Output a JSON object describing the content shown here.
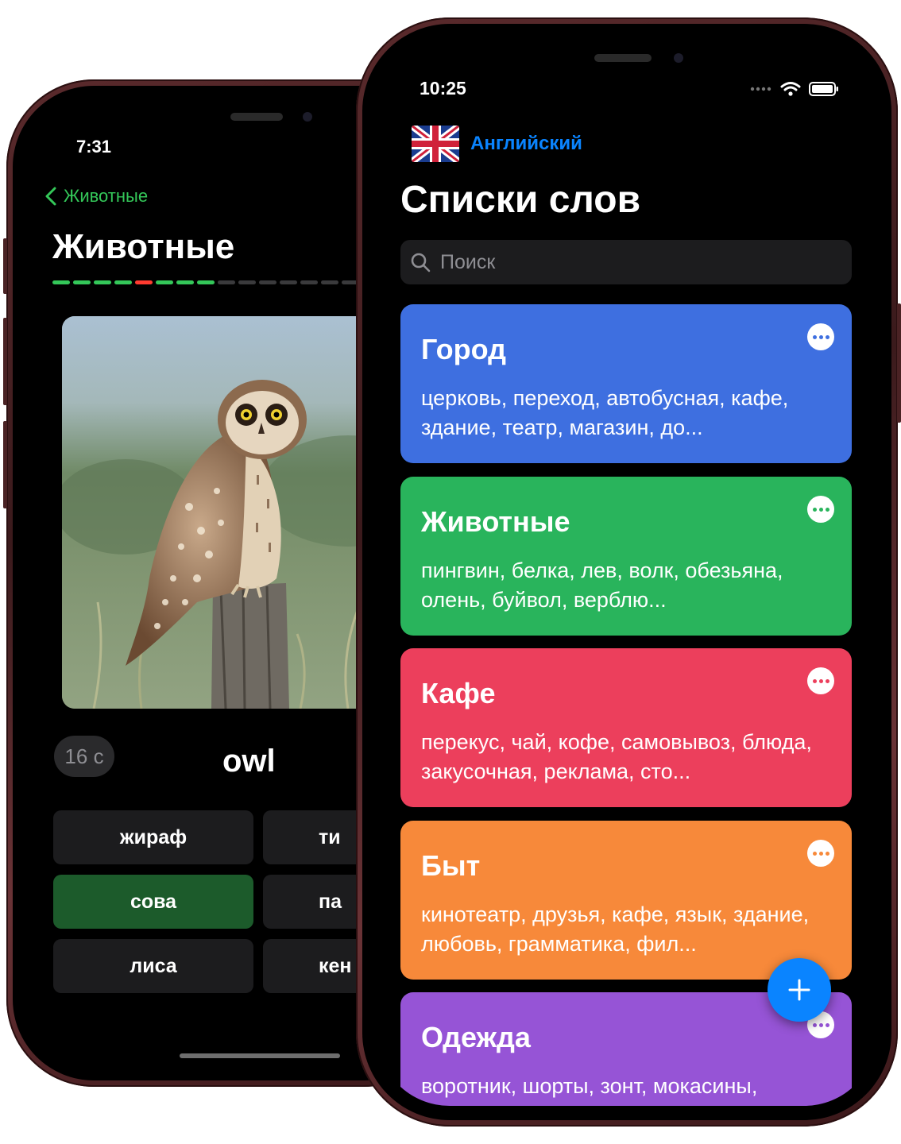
{
  "back_phone": {
    "status_time": "7:31",
    "back_label": "Животные",
    "title": "Животные",
    "progress_colors": [
      "#34c759",
      "#34c759",
      "#34c759",
      "#34c759",
      "#ff3b30",
      "#34c759",
      "#34c759",
      "#34c759",
      "#3a3a3c",
      "#3a3a3c",
      "#3a3a3c",
      "#3a3a3c",
      "#3a3a3c",
      "#3a3a3c",
      "#3a3a3c"
    ],
    "image_icon": "owl-photo",
    "timer": "16 с",
    "word": "owl",
    "answers": [
      "жираф",
      "ти",
      "сова",
      "па",
      "лиса",
      "кен"
    ],
    "correct_answer": "сова"
  },
  "front_phone": {
    "status_time": "10:25",
    "language": "Английский",
    "title": "Списки слов",
    "search_placeholder": "Поиск",
    "lists": [
      {
        "title": "Город",
        "words": "церковь, переход, автобусная, кафе, здание, театр, магазин, до...",
        "color": "#3e6fe0"
      },
      {
        "title": "Животные",
        "words": "пингвин, белка, лев, волк, обезьяна, олень, буйвол, верблю...",
        "color": "#29b45c"
      },
      {
        "title": "Кафе",
        "words": "перекус, чай, кофе, самовывоз, блюда, закусочная, реклама, сто...",
        "color": "#ec3f5c"
      },
      {
        "title": "Быт",
        "words": "кинотеатр, друзья, кафе, язык, здание, любовь, грамматика, фил...",
        "color": "#f7893a"
      },
      {
        "title": "Одежда",
        "words": "воротник, шорты, зонт, мокасины, корсет, юбка, кроссовки, куртка",
        "color": "#9654d6"
      }
    ],
    "add_button": "+"
  }
}
